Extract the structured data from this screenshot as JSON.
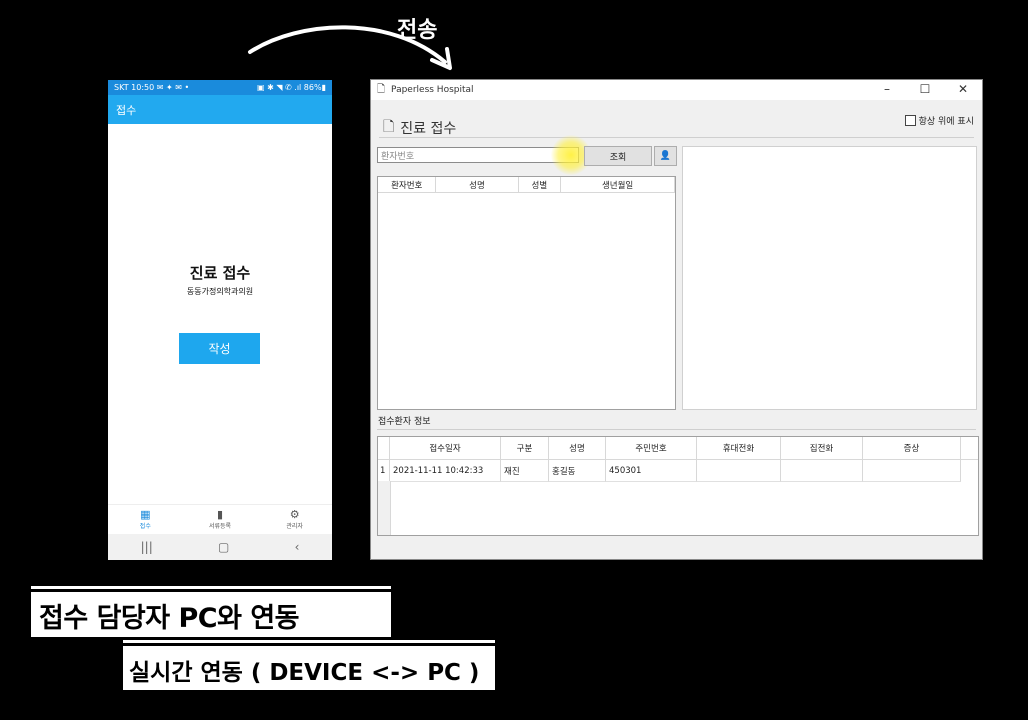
{
  "overlay": {
    "send_label": "전송",
    "caption_main": "접수 담당자 PC와 연동",
    "caption_sub": "실시간 연동 ( DEVICE <-> PC )"
  },
  "phone": {
    "status_left": "SKT 10:50 ✉ ✦ ✉ •",
    "status_right": "▣ ✱ ◥ ✆ .ıl 86%▮",
    "appbar_title": "접수",
    "title": "진료 접수",
    "subtitle": "동동가정의학과의원",
    "write_button": "작성",
    "nav": [
      {
        "label": "접수",
        "icon": "calendar-icon"
      },
      {
        "label": "서류등록",
        "icon": "document-icon"
      },
      {
        "label": "관리자",
        "icon": "gear-icon"
      }
    ],
    "sysbar": [
      "|||",
      "▢",
      "‹"
    ]
  },
  "window": {
    "title": "Paperless Hospital",
    "heading": "진료 접수",
    "always_on_top_label": "항상 위에 표시",
    "always_on_top_checked": false,
    "search_placeholder": "환자번호",
    "search_button": "조회",
    "patient_list": {
      "columns": [
        "환자번호",
        "성명",
        "성별",
        "생년월일"
      ]
    },
    "records_label": "접수환자 정보",
    "records": {
      "columns": [
        "접수일자",
        "구분",
        "성명",
        "주민번호",
        "휴대전화",
        "집전화",
        "증상"
      ],
      "rows": [
        {
          "num": "1",
          "cells": [
            "2021-11-11 10:42:33",
            "재진",
            "홍길동",
            "450301",
            "",
            "",
            ""
          ]
        }
      ]
    }
  },
  "colors": {
    "phone_accent": "#22a9ef",
    "button": "#1ea7ee",
    "highlight": "#fff03c"
  }
}
